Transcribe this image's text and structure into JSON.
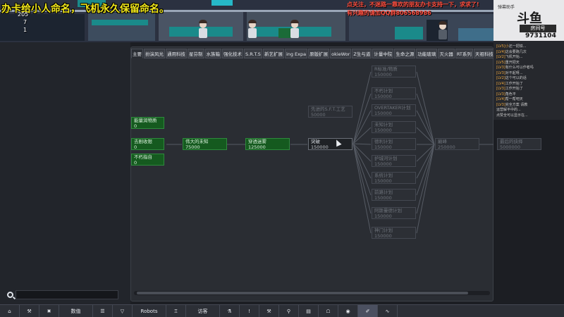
{
  "overlay": {
    "title_text": "办卡给小人命名，飞机永久保留命名。",
    "stat_top": "205",
    "stat_1": "7",
    "stat_2": "1",
    "promo_lines": [
      "点关注，不迷路一靠欢的朋友办卡支持一下，求求了!",
      "有兴趣的请加QQ群806568986"
    ]
  },
  "stream": {
    "header_label": "弹幕助手",
    "logo_text": "斗鱼",
    "room_label": "房间号",
    "room_number": "9731104",
    "chat": [
      {
        "name": "[LV5]小",
        "text": "还一把铁..."
      },
      {
        "name": "[LV4]",
        "text": "这会要跑几次"
      },
      {
        "name": "[LV2]",
        "text": "飞机开始..."
      },
      {
        "name": "[LV5]",
        "text": "重开把天"
      },
      {
        "name": "[LV3]",
        "text": "有什么可以作者吗"
      },
      {
        "name": "[LV3]",
        "text": "对不起呀..."
      },
      {
        "name": "[LV2]",
        "text": "这个可以的话"
      },
      {
        "name": "[LV4]",
        "text": "工作开始了"
      },
      {
        "name": "[LV3]",
        "text": "工作开始了"
      },
      {
        "name": "[LV3]",
        "text": "角色平"
      },
      {
        "name": "[LV4]",
        "text": "帮一帮吧天"
      },
      {
        "name": "[LV3]",
        "text": "完全方案 请教"
      },
      {
        "name": "",
        "text": "运营解平中的..."
      },
      {
        "name": "",
        "text": "点赞全可以显示在..."
      }
    ]
  },
  "tabs": [
    {
      "label": "主要",
      "active": true
    },
    {
      "label": "扮演风光",
      "active": false
    },
    {
      "label": "通用科技",
      "active": false
    },
    {
      "label": "星芬制",
      "active": false
    },
    {
      "label": "水族箱",
      "active": false
    },
    {
      "label": "强化技术",
      "active": false
    },
    {
      "label": "S.R.T.S",
      "active": false
    },
    {
      "label": "新艺扩展",
      "active": false
    },
    {
      "label": "ing Expa",
      "active": false
    },
    {
      "label": "原版扩展",
      "active": false
    },
    {
      "label": "okieWor",
      "active": false
    },
    {
      "label": "Z生与道",
      "active": false
    },
    {
      "label": "计量中院",
      "active": false
    },
    {
      "label": "生命之源",
      "active": false
    },
    {
      "label": "功能玻璃",
      "active": false
    },
    {
      "label": "灭火器",
      "active": false
    },
    {
      "label": "RT系列",
      "active": false
    },
    {
      "label": "天祖科技",
      "active": false
    },
    {
      "label": "门类研究",
      "active": false
    },
    {
      "label": "孔科技",
      "active": false
    }
  ],
  "nodes": {
    "left1": {
      "title": "能量润物质",
      "cost": "0"
    },
    "left2": {
      "title": "去剧收限",
      "cost": "0"
    },
    "left3": {
      "title": "不朽指自",
      "cost": "0"
    },
    "greatUnknown": {
      "title": "伟大的未知",
      "cost": "75000"
    },
    "penetrate": {
      "title": "穿透迷雾",
      "cost": "125000"
    },
    "breakthrough": {
      "title": "突破",
      "cost": "150000"
    },
    "faint": {
      "title": "先进的S.F.T.工艺",
      "cost": "50000"
    },
    "r1": {
      "title": "R标准/物质",
      "cost": "150000"
    },
    "r2": {
      "title": "不朽计划",
      "cost": "150000"
    },
    "r3": {
      "title": "OVERTAKER计划",
      "cost": "150000"
    },
    "r4": {
      "title": "未知计划",
      "cost": "150000"
    },
    "r5": {
      "title": "德利计划",
      "cost": "150000"
    },
    "r6": {
      "title": "护城河计划",
      "cost": "150000"
    },
    "r7": {
      "title": "系统计划",
      "cost": "150000"
    },
    "r8": {
      "title": "前路计划",
      "cost": "150000"
    },
    "r9": {
      "title": "阿斯曼德计划",
      "cost": "150000"
    },
    "r10": {
      "title": "神门计划",
      "cost": "150000"
    },
    "peak": {
      "title": "巅峰",
      "cost": "250000"
    },
    "final": {
      "title": "最后的抉择",
      "cost": "5000000"
    }
  },
  "toolbar": {
    "items": [
      {
        "label": "",
        "icon": "home-icon"
      },
      {
        "label": "",
        "icon": "hammer-icon"
      },
      {
        "label": "",
        "icon": "cross-tools-icon"
      },
      {
        "label": "数值",
        "icon": ""
      },
      {
        "label": "",
        "icon": "list-icon"
      },
      {
        "label": "",
        "icon": "cup-icon"
      },
      {
        "label": "Robots",
        "icon": ""
      },
      {
        "label": "",
        "icon": "building-icon"
      },
      {
        "label": "访客",
        "icon": ""
      },
      {
        "label": "",
        "icon": "flask-icon"
      },
      {
        "label": "",
        "icon": "alert-icon"
      },
      {
        "label": "",
        "icon": "hammer2-icon"
      },
      {
        "label": "",
        "icon": "magnifier-icon"
      },
      {
        "label": "",
        "icon": "book-icon"
      },
      {
        "label": "",
        "icon": "bank-icon"
      },
      {
        "label": "",
        "icon": "bulb-icon"
      },
      {
        "label": "",
        "icon": "brush-icon"
      },
      {
        "label": "",
        "icon": "wave-icon"
      }
    ]
  },
  "search": {
    "value": "",
    "placeholder": ""
  }
}
